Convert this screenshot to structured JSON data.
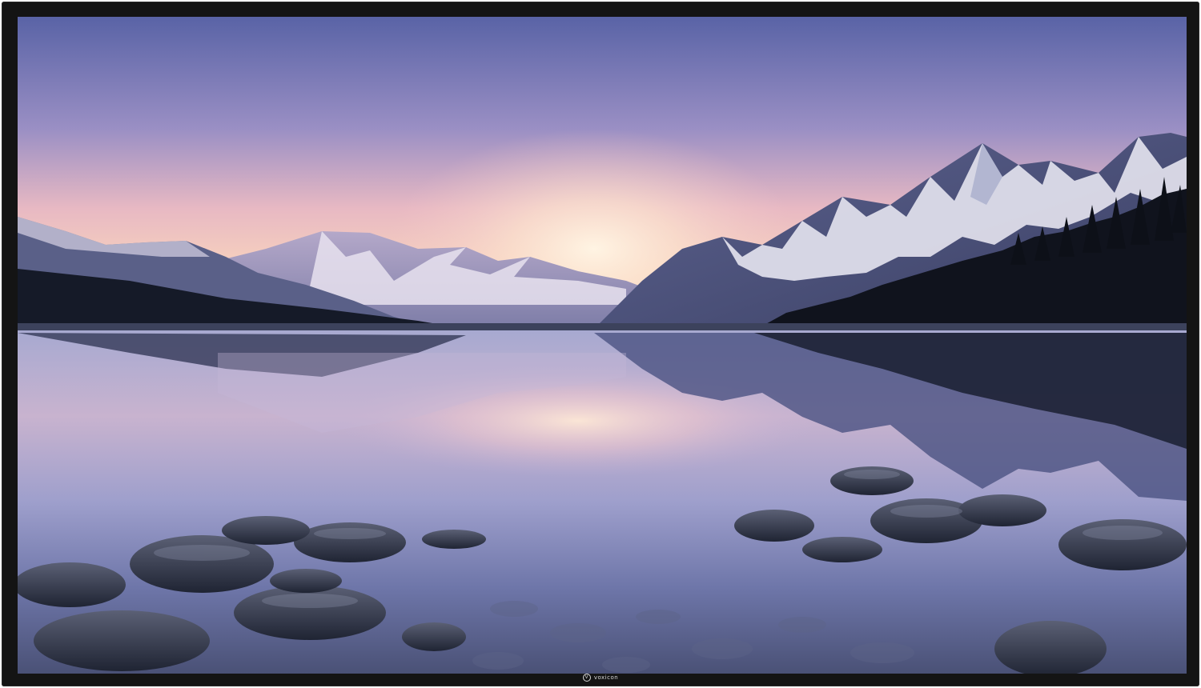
{
  "display": {
    "brand_name": "voxicon",
    "brand_logo_letter": "V",
    "bezel_color": "#141414"
  },
  "wallpaper": {
    "subject": "mountain-lake-sunrise",
    "colors": {
      "sky_top": "#5c67a8",
      "sky_glow": "#f9cdb6",
      "snow": "#e8e6f2",
      "forest": "#10131d",
      "water": "#7d84b6",
      "rocks": "#2f3547"
    }
  }
}
